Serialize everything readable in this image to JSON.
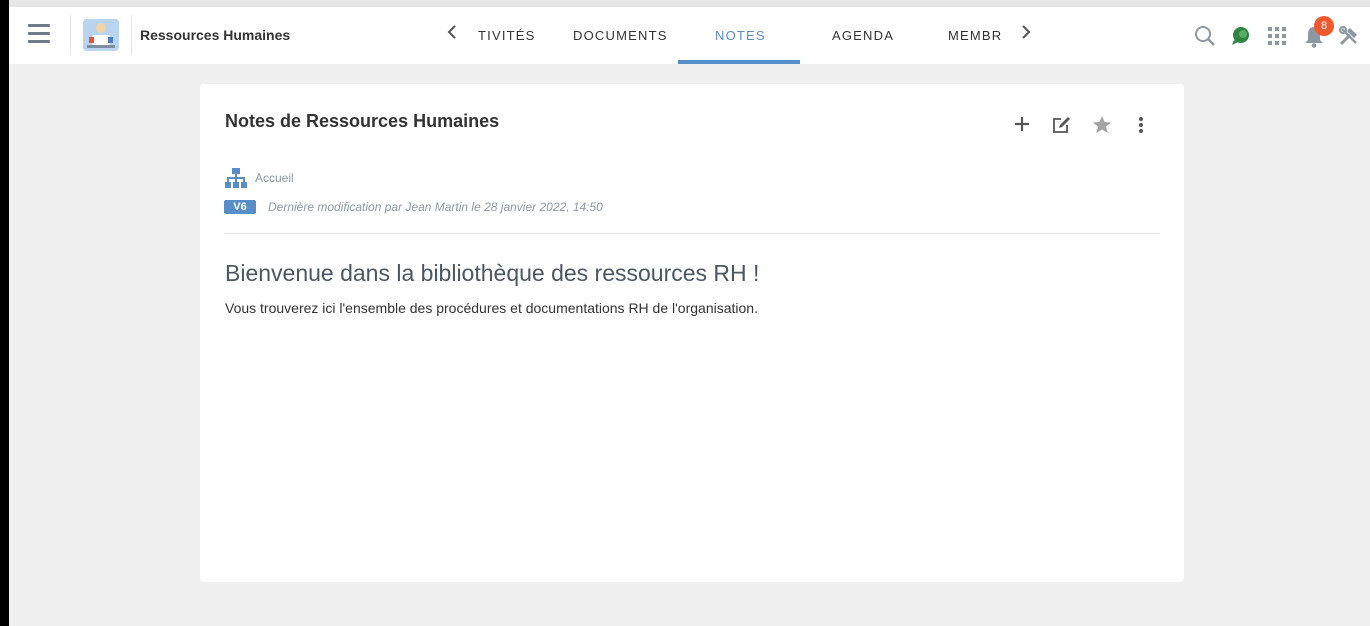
{
  "header": {
    "space_title": "Ressources Humaines",
    "tabs": [
      {
        "label": "TIVITÉS"
      },
      {
        "label": "DOCUMENTS"
      },
      {
        "label": "NOTES"
      },
      {
        "label": "AGENDA"
      },
      {
        "label": "MEMBR"
      }
    ],
    "active_tab": "NOTES",
    "notification_count": "8",
    "icons": [
      "menu-icon",
      "search-icon",
      "chat-icon",
      "apps-icon",
      "bell-icon",
      "tools-icon"
    ]
  },
  "note": {
    "title": "Notes de Ressources Humaines",
    "breadcrumb": "Accueil",
    "version": "V6",
    "last_modified": "Dernière modification par Jean Martin le 28 janvier 2022, 14:50",
    "heading": "Bienvenue dans la bibliothèque des ressources RH !",
    "body": "Vous trouverez ici l'ensemble des procédures et documentations RH de l'organisation.",
    "actions": [
      "plus-icon",
      "edit-icon",
      "star-icon",
      "more-vertical-icon"
    ]
  },
  "colors": {
    "accent": "#578dc9",
    "badge": "#f0592e",
    "chat": "#2e8540",
    "background": "#f0f0f0"
  }
}
